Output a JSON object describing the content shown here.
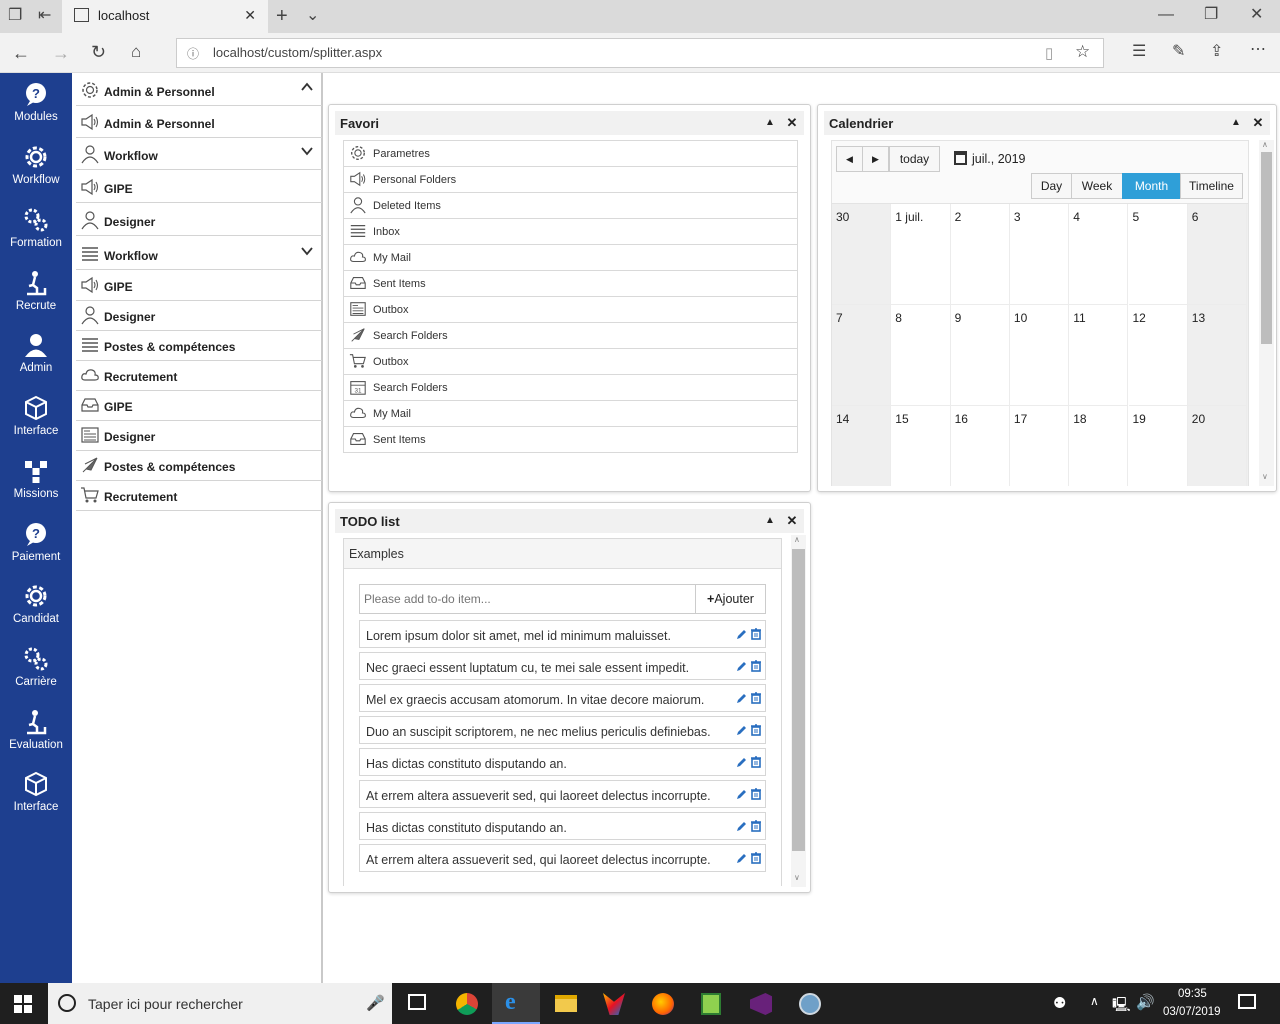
{
  "browser": {
    "tab_title": "localhost",
    "url": "localhost/custom/splitter.aspx"
  },
  "nav": {
    "items": [
      {
        "label": "Modules",
        "icon": "chat-question-icon"
      },
      {
        "label": "Workflow",
        "icon": "gear-icon"
      },
      {
        "label": "Formation",
        "icon": "gears-icon"
      },
      {
        "label": "Recrute",
        "icon": "climber-icon"
      },
      {
        "label": "Admin",
        "icon": "user-icon"
      },
      {
        "label": "Interface",
        "icon": "cube-icon"
      },
      {
        "label": "Missions",
        "icon": "network-icon"
      },
      {
        "label": "Paiement",
        "icon": "chat-question-icon"
      },
      {
        "label": "Candidat",
        "icon": "gear-icon"
      },
      {
        "label": "Carrière",
        "icon": "gears-icon"
      },
      {
        "label": "Evaluation",
        "icon": "climber-icon"
      },
      {
        "label": "Interface",
        "icon": "cube-icon"
      }
    ]
  },
  "tree": {
    "items": [
      {
        "label": "Admin & Personnel",
        "icon": "gear-icon",
        "chevron": "up"
      },
      {
        "label": "Admin & Personnel",
        "icon": "speaker-icon",
        "chevron": ""
      },
      {
        "label": "Workflow",
        "icon": "user-icon",
        "chevron": "down"
      },
      {
        "label": "GIPE",
        "icon": "speaker-icon",
        "chevron": ""
      },
      {
        "label": "Designer",
        "icon": "user-icon",
        "chevron": ""
      },
      {
        "label": "Workflow",
        "icon": "list-icon",
        "chevron": "down"
      },
      {
        "label": "GIPE",
        "icon": "speaker-icon",
        "chevron": ""
      },
      {
        "label": "Designer",
        "icon": "user-icon",
        "chevron": ""
      },
      {
        "label": "Postes & compétences",
        "icon": "list-icon",
        "chevron": ""
      },
      {
        "label": "Recrutement",
        "icon": "cloud-icon",
        "chevron": ""
      },
      {
        "label": "GIPE",
        "icon": "tray-icon",
        "chevron": ""
      },
      {
        "label": "Designer",
        "icon": "newspaper-icon",
        "chevron": ""
      },
      {
        "label": "Postes & compétences",
        "icon": "rocket-icon",
        "chevron": ""
      },
      {
        "label": "Recrutement",
        "icon": "cart-icon",
        "chevron": ""
      }
    ]
  },
  "favori": {
    "title": "Favori",
    "items": [
      {
        "label": "Parametres",
        "icon": "gear-icon"
      },
      {
        "label": "Personal Folders",
        "icon": "speaker-icon"
      },
      {
        "label": "Deleted Items",
        "icon": "user-icon"
      },
      {
        "label": "Inbox",
        "icon": "list-icon"
      },
      {
        "label": "My Mail",
        "icon": "cloud-icon"
      },
      {
        "label": "Sent Items",
        "icon": "tray-icon"
      },
      {
        "label": "Outbox",
        "icon": "newspaper-icon"
      },
      {
        "label": "Search Folders",
        "icon": "rocket-icon"
      },
      {
        "label": "Outbox",
        "icon": "cart-icon"
      },
      {
        "label": "Search Folders",
        "icon": "calendar-icon"
      },
      {
        "label": "My Mail",
        "icon": "cloud-icon"
      },
      {
        "label": "Sent Items",
        "icon": "tray-icon"
      }
    ]
  },
  "calendar": {
    "title": "Calendrier",
    "today_label": "today",
    "current": "juil., 2019",
    "views": [
      "Day",
      "Week",
      "Month",
      "Timeline"
    ],
    "active_view": "Month",
    "weeks": [
      [
        "30",
        "1 juil.",
        "2",
        "3",
        "4",
        "5",
        "6"
      ],
      [
        "7",
        "8",
        "9",
        "10",
        "11",
        "12",
        "13"
      ],
      [
        "14",
        "15",
        "16",
        "17",
        "18",
        "19",
        "20"
      ]
    ]
  },
  "todo": {
    "title": "TODO list",
    "section": "Examples",
    "placeholder": "Please add to-do item...",
    "add_label": "Ajouter",
    "items": [
      "Lorem ipsum dolor sit amet, mel id minimum maluisset.",
      "Nec graeci essent luptatum cu, te mei sale essent impedit.",
      "Mel ex graecis accusam atomorum. In vitae decore maiorum.",
      "Duo an suscipit scriptorem, ne nec melius periculis definiebas.",
      "Has dictas constituto disputando an.",
      "At errem altera assueverit sed, qui laoreet delectus incorrupte.",
      "Has dictas constituto disputando an.",
      "At errem altera assueverit sed, qui laoreet delectus incorrupte."
    ]
  },
  "taskbar": {
    "search_placeholder": "Taper ici pour rechercher",
    "time": "09:35",
    "date": "03/07/2019"
  },
  "colors": {
    "nav_bg": "#1e3f8f",
    "accent": "#2f9fd8",
    "edit_icon": "#2a6fc0"
  }
}
